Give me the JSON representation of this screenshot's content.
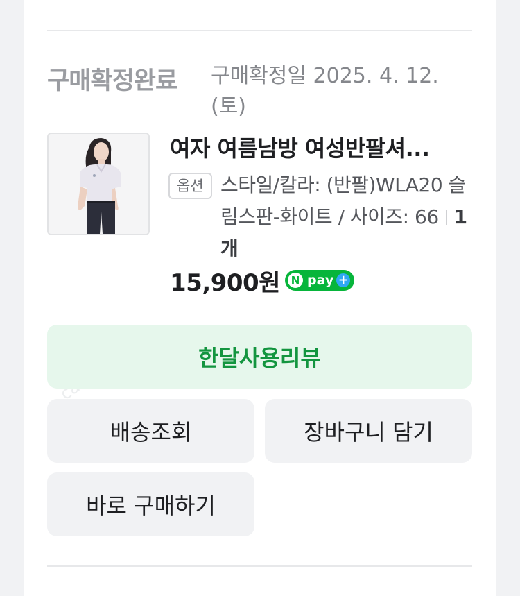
{
  "order": {
    "status": "구매확정완료",
    "confirm_date": "구매확정일 2025. 4. 12. (토)"
  },
  "product": {
    "name": "여자 여름남방 여성반팔셔...",
    "option_badge": "옵션",
    "option_text": "스타일/칼라: (반팔)WLA20 슬림스판-화이트 / 사이즈: 66",
    "quantity": "1개",
    "price": "15,900원",
    "pay_badge": {
      "n": "N",
      "text": "pay",
      "plus": "+"
    }
  },
  "buttons": {
    "review": "한달사용리뷰",
    "track_delivery": "배송조회",
    "add_to_cart": "장바구니 담기",
    "buy_now": "바로 구매하기"
  },
  "colors": {
    "accent_green": "#13953f",
    "accent_green_bg": "#e6f7ec",
    "npay_green": "#07b53b"
  }
}
